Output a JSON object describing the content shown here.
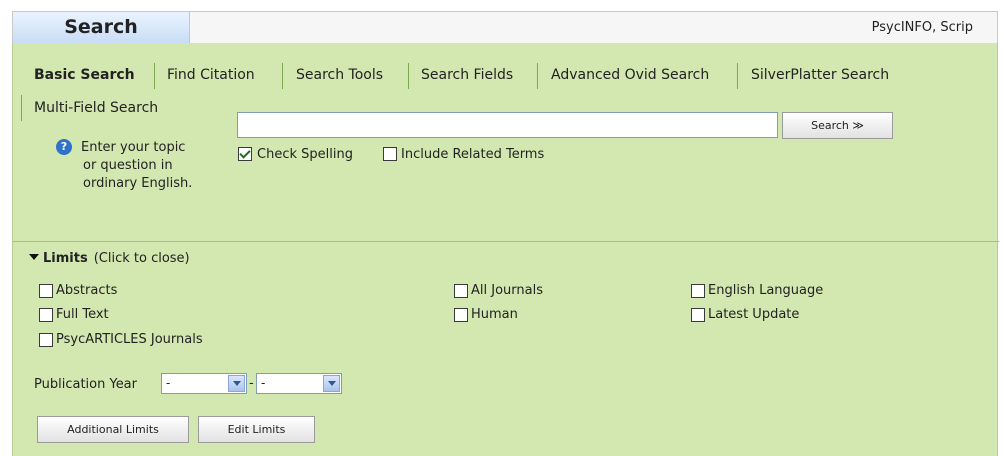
{
  "header": {
    "search_tab": "Search",
    "database": "PsycINFO, Scrip"
  },
  "tabs": [
    "Basic Search",
    "Find Citation",
    "Search Tools",
    "Search Fields",
    "Advanced Ovid Search",
    "SilverPlatter Search",
    "Multi-Field Search"
  ],
  "query": {
    "help_lines": [
      "Enter your topic",
      "or question in",
      "ordinary English."
    ],
    "value": "",
    "search_button": "Search ≫",
    "check_spelling": {
      "label": "Check Spelling",
      "checked": true
    },
    "related_terms": {
      "label": "Include Related Terms",
      "checked": false
    }
  },
  "limits": {
    "title": "Limits",
    "hint": "(Click to close)",
    "options": [
      {
        "label": "Abstracts",
        "checked": false
      },
      {
        "label": "Full Text",
        "checked": false
      },
      {
        "label": "PsycARTICLES Journals",
        "checked": false
      },
      {
        "label": "All Journals",
        "checked": false
      },
      {
        "label": "Human",
        "checked": false
      },
      {
        "label": "English Language",
        "checked": false
      },
      {
        "label": "Latest Update",
        "checked": false
      }
    ],
    "pub_year_label": "Publication Year",
    "year_from": "-",
    "year_sep": "-",
    "year_to": "-",
    "additional_button": "Additional Limits",
    "edit_button": "Edit Limits"
  },
  "colors": {
    "panel": "#d3e8b1",
    "tab_separator": "#7da84d",
    "header_tab": "#c9ddf6"
  }
}
